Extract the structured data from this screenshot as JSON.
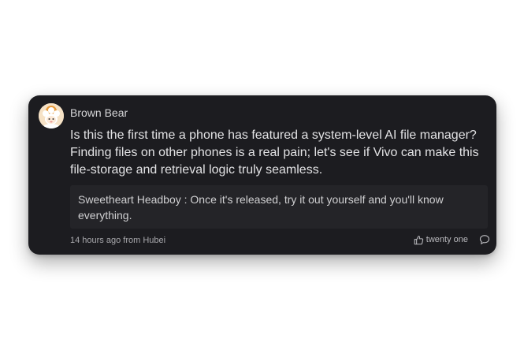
{
  "comment": {
    "author": "Brown Bear",
    "avatar_icon": "sheep-avatar-icon",
    "text": "Is this the first time a phone has featured a system-level AI file manager? Finding files on other phones is a real pain; let's see if Vivo can make this file-storage and retrieval logic truly seamless.",
    "reply": {
      "text": "Sweetheart Headboy : Once it's released, try it out yourself and you'll know everything."
    },
    "meta": "14 hours ago from Hubei",
    "likes_label": "twenty one",
    "like_icon": "thumbs-up-icon",
    "reply_icon": "comment-bubble-icon"
  },
  "colors": {
    "card_background": "#1c1c20",
    "reply_background": "#242428",
    "text_primary": "#e2e2e4",
    "text_secondary": "#a9a9ad"
  }
}
